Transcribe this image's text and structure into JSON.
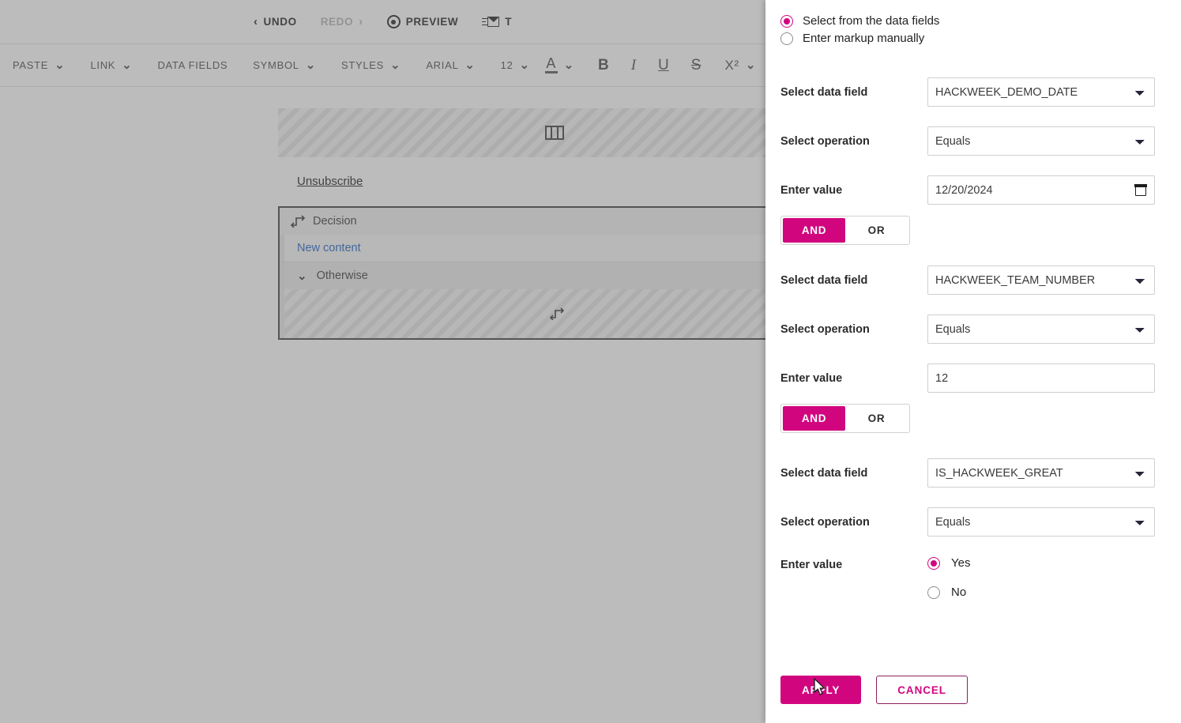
{
  "editor": {
    "topbar": {
      "undo": "UNDO",
      "redo": "REDO",
      "preview": "PREVIEW",
      "test": "T"
    },
    "formatbar": {
      "paste": "PASTE",
      "link": "LINK",
      "data_fields": "DATA FIELDS",
      "symbol": "SYMBOL",
      "styles": "STYLES",
      "font_family": "ARIAL",
      "font_size": "12",
      "bold": "B",
      "italic": "I",
      "underline": "U",
      "strikethrough": "S",
      "superscript": "X²"
    },
    "canvas": {
      "unsubscribe": "Unsubscribe",
      "decision_title": "Decision",
      "new_content": "New content",
      "otherwise": "Otherwise"
    }
  },
  "panel": {
    "mode": {
      "select_fields": "Select from the data fields",
      "enter_markup": "Enter markup manually",
      "selected": "select_fields"
    },
    "labels": {
      "data_field": "Select data field",
      "operation": "Select operation",
      "value": "Enter value"
    },
    "conditions": [
      {
        "data_field": "HACKWEEK_DEMO_DATE",
        "operation": "Equals",
        "value": "12/20/2024",
        "value_type": "date",
        "connector": {
          "and": "AND",
          "or": "OR",
          "selected": "AND"
        }
      },
      {
        "data_field": "HACKWEEK_TEAM_NUMBER",
        "operation": "Equals",
        "value": "12",
        "value_type": "text",
        "connector": {
          "and": "AND",
          "or": "OR",
          "selected": "AND"
        }
      },
      {
        "data_field": "IS_HACKWEEK_GREAT",
        "operation": "Equals",
        "value": "Yes",
        "value_type": "boolean",
        "options": {
          "yes": "Yes",
          "no": "No"
        },
        "connector": null
      }
    ],
    "footer": {
      "apply": "APPLY",
      "cancel": "CANCEL"
    }
  },
  "colors": {
    "accent": "#D1067F",
    "cancel_border": "#8E1F5C",
    "dim_overlay": "#999999",
    "link_blue": "#1F63C4"
  }
}
